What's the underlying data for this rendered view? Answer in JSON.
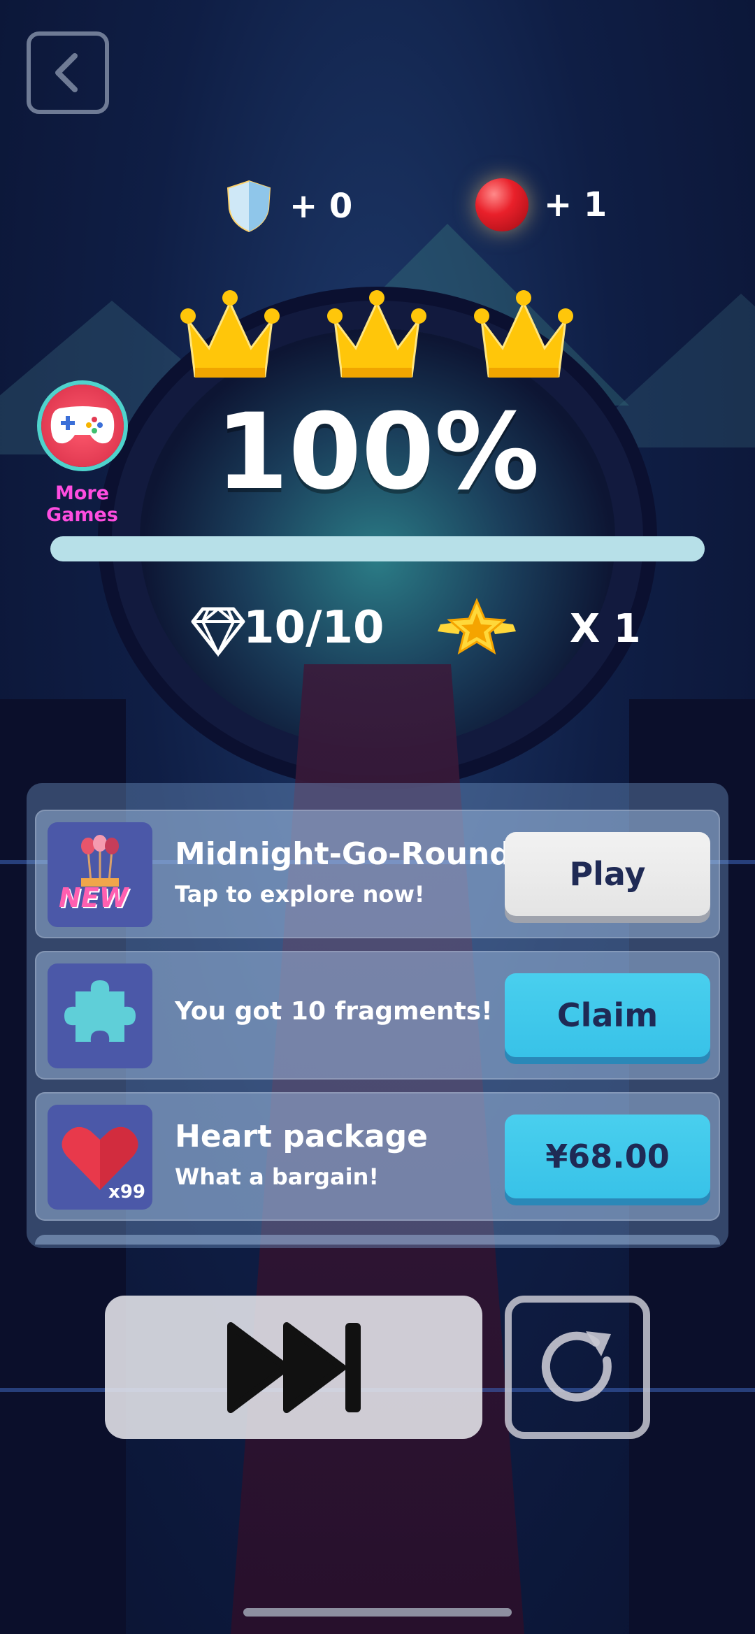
{
  "header": {
    "back_icon": "back-chevron-icon"
  },
  "rewards": [
    {
      "icon": "shield-icon",
      "label": "+ 0"
    },
    {
      "icon": "red-ball-icon",
      "label": "+ 1"
    }
  ],
  "crowns": {
    "earned": 3,
    "total": 3,
    "icon": "crown-icon"
  },
  "result": {
    "percent_label": "100%",
    "progress": 1.0
  },
  "more_games": {
    "label": "More Games",
    "icon": "gamepad-icon"
  },
  "stats": {
    "diamonds": "10/10",
    "star_multiplier": "X 1"
  },
  "offers": [
    {
      "icon": "new-balloons-icon",
      "icon_label": "NEW",
      "title": "Midnight-Go-Round",
      "subtitle": "Tap to explore now!",
      "button": "Play"
    },
    {
      "icon": "puzzle-piece-icon",
      "text": "You got 10 fragments!",
      "button": "Claim"
    },
    {
      "icon": "heart-icon",
      "icon_label": "x99",
      "title": "Heart package",
      "subtitle": "What a bargain!",
      "button": "¥68.00"
    }
  ],
  "colors": {
    "accent_blue": "#3ec7ec",
    "more_games_pink": "#ff4de0",
    "crown_gold": "#ffc60a"
  }
}
